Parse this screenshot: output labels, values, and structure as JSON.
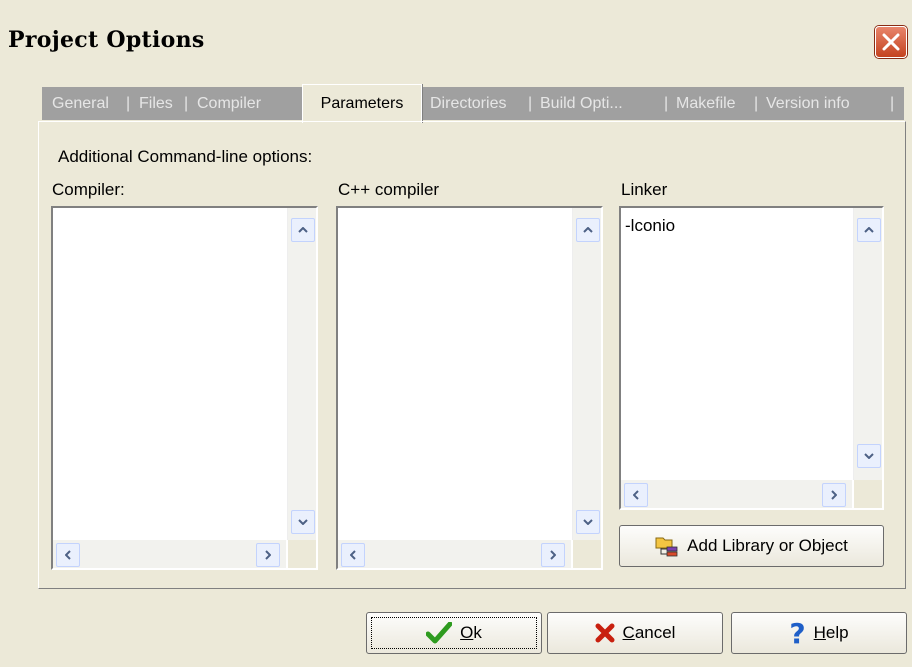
{
  "window": {
    "title": "Project Options"
  },
  "tabs": [
    {
      "label": "General"
    },
    {
      "label": "Files"
    },
    {
      "label": "Compiler"
    },
    {
      "label": "Parameters",
      "active": true
    },
    {
      "label": "Directories"
    },
    {
      "label": "Build Opti..."
    },
    {
      "label": "Makefile"
    },
    {
      "label": "Version info"
    }
  ],
  "tab_separator": "|",
  "parameters": {
    "heading": "Additional Command-line options:",
    "compiler_label": "Compiler:",
    "cpp_compiler_label": "C++ compiler",
    "linker_label": "Linker",
    "compiler_value": "",
    "cpp_compiler_value": "",
    "linker_value": "-lconio",
    "add_library_label": "Add Library or Object"
  },
  "buttons": {
    "ok_mnemonic": "O",
    "ok_rest": "k",
    "cancel_mnemonic": "C",
    "cancel_rest": "ancel",
    "help_mnemonic": "H",
    "help_rest": "elp"
  },
  "colors": {
    "ok_check": "#2e9b1f",
    "cancel_x": "#c8200f",
    "help_q": "#1f5fc8"
  },
  "icons": [
    "close-icon",
    "checkmark-icon",
    "x-icon",
    "question-icon",
    "folder-library-icon",
    "scroll-up-arrow-icon",
    "scroll-down-arrow-icon",
    "scroll-left-arrow-icon",
    "scroll-right-arrow-icon"
  ]
}
